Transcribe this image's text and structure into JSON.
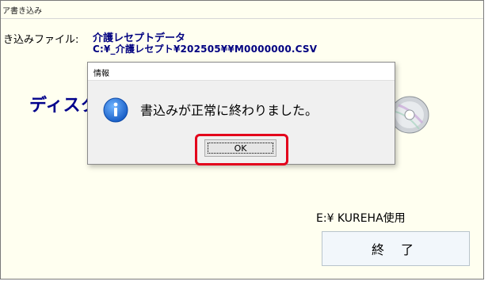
{
  "window": {
    "title": "ア書き込み"
  },
  "main": {
    "file_label": "き込みファイル:",
    "file_name": "介護レセプトデータ",
    "file_path": "C:¥_介護レセプト¥202505¥¥M0000000.CSV",
    "disk_text": "ディスク",
    "drive_label": "E:¥ KUREHA使用",
    "exit_label": "終 了"
  },
  "dialog": {
    "title": "情報",
    "message": "書込みが正常に終わりました。",
    "ok_label": "OK",
    "icon": "info-icon"
  },
  "colors": {
    "background": "#fffff0",
    "header_text": "#000080",
    "highlight": "#e3001b",
    "info_icon": "#1b6fd1"
  }
}
